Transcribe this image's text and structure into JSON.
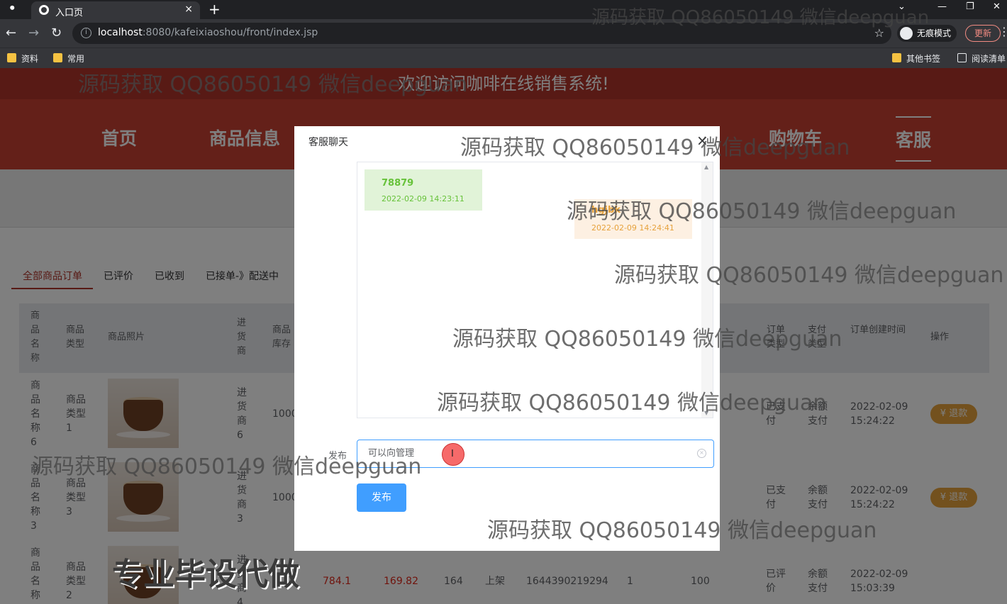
{
  "browser": {
    "tab_title": "入口页",
    "new_tab": "+",
    "close_tab": "×",
    "window_buttons": [
      "⌄",
      "—",
      "❐",
      "✕"
    ],
    "url_host": "localhost",
    "url_path": ":8080/kafeixiaoshou/front/index.jsp",
    "incognito_label": "无痕模式",
    "update_label": "更新",
    "menu_dots": "⋮",
    "bookmarks": [
      "资料",
      "常用",
      "其他书签",
      "阅读清单"
    ]
  },
  "site": {
    "welcome": "欢迎访问咖啡在线销售系统!",
    "nav": [
      "首页",
      "商品信息",
      "购物车",
      "客服"
    ]
  },
  "order_tabs": [
    "全部商品订单",
    "已评价",
    "已收到",
    "已接单-》配送中"
  ],
  "table": {
    "headers": {
      "name": "商品名称",
      "type": "商品类型",
      "photo": "商品照片",
      "supplier": "进货商",
      "stock": "商品库存",
      "order_type": "订单类型",
      "pay_type": "支付类型",
      "created": "订单创建时间",
      "action": "操作"
    },
    "rows": [
      {
        "name": "商品名称6",
        "type": "商品类型1",
        "supplier": "进货商6",
        "stock": "1000",
        "status": "已支付",
        "pay": "余额支付",
        "date": "2022-02-09",
        "time": "15:24:22",
        "action": "¥ 退款"
      },
      {
        "name": "商品名称3",
        "type": "商品类型3",
        "supplier": "进货商3",
        "stock": "1000",
        "status": "已支付",
        "pay": "余额支付",
        "date": "2022-02-09",
        "time": "15:24:22",
        "action": "¥ 退款"
      },
      {
        "name": "商品名称",
        "type": "商品类型2",
        "supplier": "进货商4",
        "price1": "784.1",
        "price2": "169.82",
        "qty": "164",
        "shelf": "上架",
        "order_no": "1644390219294",
        "count": "1",
        "total": "100",
        "status": "已评价",
        "pay": "余额支付",
        "date": "2022-02-09",
        "time": "15:03:39"
      }
    ]
  },
  "dialog": {
    "title": "客服聊天",
    "close": "×",
    "messages": [
      {
        "text": "78879",
        "time": "2022-02-09 14:23:11"
      },
      {
        "text": "hgjbk",
        "time": "2022-02-09 14:24:41"
      }
    ],
    "post_label": "发布",
    "input_value": "可以向管理",
    "post_button": "发布",
    "scroll_up": "▲",
    "scroll_down": "▼",
    "clear": "×"
  },
  "watermarks": {
    "text": "源码获取 QQ86050149 微信deepguan",
    "big": "专业毕设代做"
  }
}
